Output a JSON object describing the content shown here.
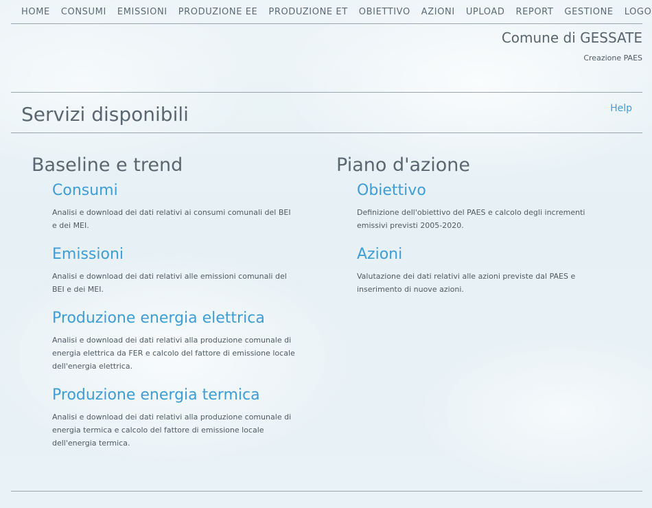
{
  "nav": [
    "HOME",
    "CONSUMI",
    "EMISSIONI",
    "PRODUZIONE EE",
    "PRODUZIONE ET",
    "OBIETTIVO",
    "AZIONI",
    "UPLOAD",
    "REPORT",
    "GESTIONE",
    "LOGOUT"
  ],
  "header": {
    "comune": "Comune di GESSATE",
    "subtitle": "Creazione PAES"
  },
  "page": {
    "title": "Servizi disponibili",
    "help": "Help"
  },
  "sections": {
    "left": {
      "title": "Baseline e trend",
      "items": [
        {
          "title": "Consumi",
          "desc": "Analisi e download dei dati relativi ai consumi comunali del BEI e dei MEI."
        },
        {
          "title": "Emissioni",
          "desc": "Analisi e download dei dati relativi alle emissioni comunali del BEI e dei MEI."
        },
        {
          "title": "Produzione energia elettrica",
          "desc": "Analisi e download dei dati relativi alla produzione comunale di energia elettrica da FER e calcolo del fattore di emissione locale dell'energia elettrica."
        },
        {
          "title": "Produzione energia termica",
          "desc": "Analisi e download dei dati relativi alla produzione comunale di energia termica e calcolo del fattore di emissione locale dell'energia termica."
        }
      ]
    },
    "right": {
      "title": "Piano d'azione",
      "items": [
        {
          "title": "Obiettivo",
          "desc": "Definizione dell'obiettivo del PAES e calcolo degli incrementi emissivi previsti 2005-2020."
        },
        {
          "title": "Azioni",
          "desc": "Valutazione dei dati relativi alle azioni previste dal PAES e inserimento di nuove azioni."
        }
      ]
    }
  }
}
